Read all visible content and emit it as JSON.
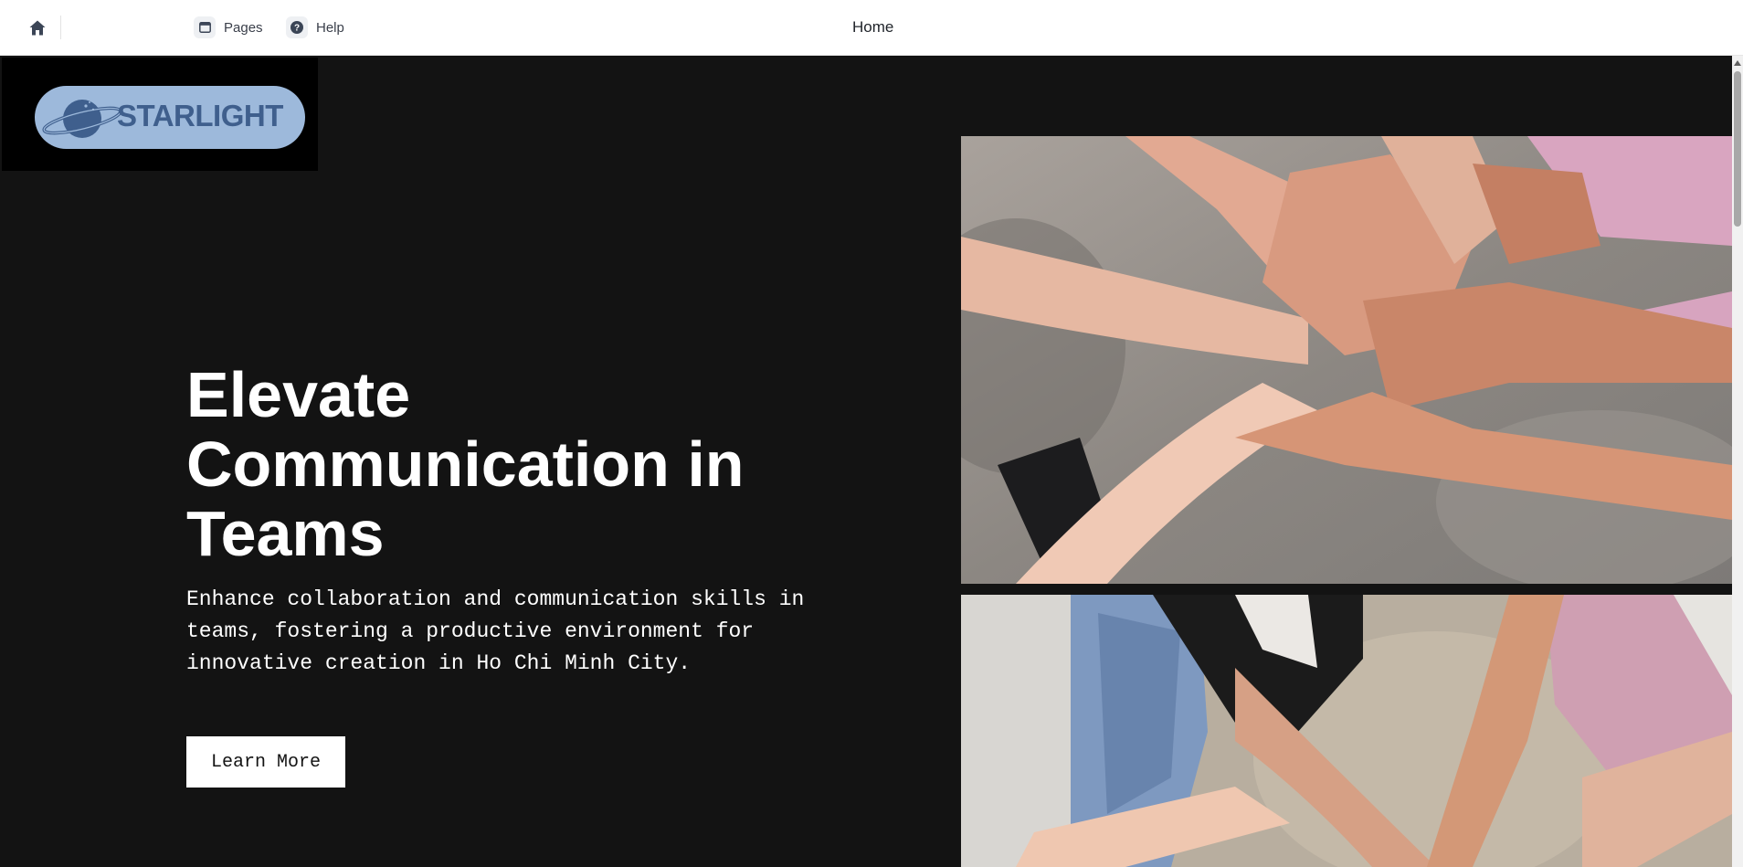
{
  "topbar": {
    "home_icon": "home-icon",
    "pages_label": "Pages",
    "pages_icon": "window-icon",
    "help_label": "Help",
    "help_icon": "help-circle-icon",
    "page_title": "Home"
  },
  "hero": {
    "logo_text": "STARLIGHT",
    "headline": "Elevate Communication in Teams",
    "subtext": "Enhance collaboration and communication skills in teams, fostering a productive environment for innovative creation in Ho Chi Minh City.",
    "cta_label": "Learn More",
    "images": [
      "stacked-hands-photo",
      "circle-of-hands-photo"
    ]
  },
  "colors": {
    "hero_bg": "#131313",
    "logo_pill": "#9db9db",
    "logo_text": "#3f5f8d",
    "text": "#ffffff"
  }
}
